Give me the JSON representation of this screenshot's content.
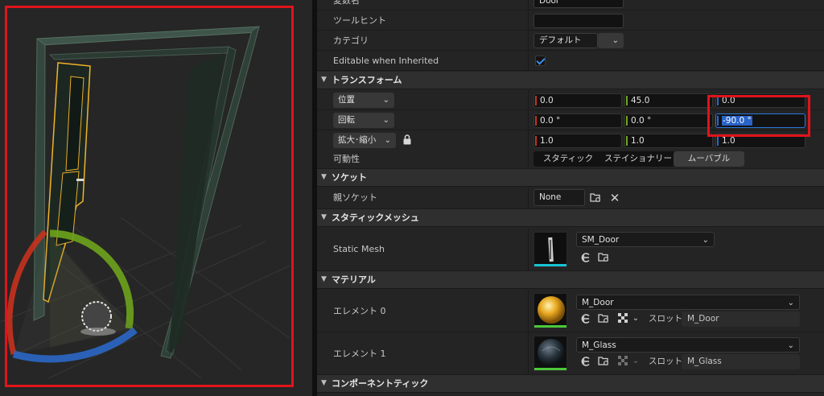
{
  "details": {
    "rows": {
      "variable_name": {
        "label": "変数名",
        "value": "Door"
      },
      "tooltip": {
        "label": "ツールヒント",
        "value": ""
      },
      "category": {
        "label": "カテゴリ",
        "value": "デフォルト"
      },
      "editable": {
        "label": "Editable when Inherited",
        "checked": true
      }
    },
    "transform": {
      "title": "トランスフォーム",
      "location": {
        "mode": "位置",
        "x": "0.0",
        "y": "45.0",
        "z": "0.0"
      },
      "rotation": {
        "mode": "回転",
        "x": "0.0 °",
        "y": "0.0 °",
        "z": "-90.0 °"
      },
      "scale": {
        "mode": "拡大･縮小",
        "x": "1.0",
        "y": "1.0",
        "z": "1.0"
      },
      "mobility": {
        "label": "可動性",
        "options": [
          "スタティック",
          "ステイショナリー",
          "ムーバブル"
        ],
        "selected": "ムーバブル"
      }
    },
    "socket": {
      "title": "ソケット",
      "parent_label": "親ソケット",
      "parent_value": "None"
    },
    "static_mesh": {
      "title": "スタティックメッシュ",
      "label": "Static Mesh",
      "value": "SM_Door"
    },
    "material": {
      "title": "マテリアル",
      "slot_label": "スロット",
      "elements": [
        {
          "label": "エレメント 0",
          "value": "M_Door",
          "slot": "M_Door"
        },
        {
          "label": "エレメント 1",
          "value": "M_Glass",
          "slot": "M_Glass"
        }
      ]
    },
    "component_tick": {
      "title": "コンポーネントティック"
    }
  },
  "colors": {
    "highlight": "#e0141b",
    "axis_x": "#c8321e",
    "axis_y": "#6ea41c",
    "axis_z": "#2b68c8",
    "selection": "#2a63c8"
  },
  "icons": [
    "lock-icon",
    "browse-icon",
    "clear-icon",
    "use-selected-icon",
    "checker-icon",
    "chevron-down-icon",
    "collapse-arrow-icon"
  ]
}
